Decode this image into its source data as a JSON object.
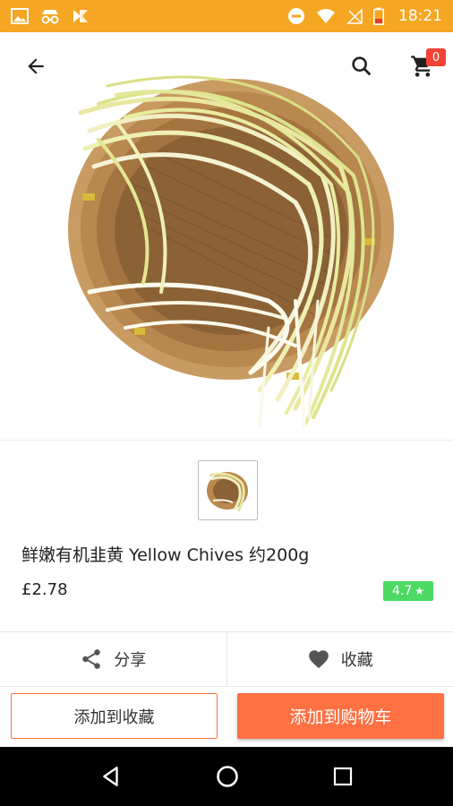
{
  "status_bar": {
    "time": "18:21",
    "icons_left": [
      "image-icon",
      "incognito-icon",
      "delivery-icon"
    ],
    "icons_right": [
      "do-not-disturb-icon",
      "wifi-icon",
      "no-signal-icon",
      "battery-icon"
    ]
  },
  "toolbar": {
    "cart_count": "0"
  },
  "product": {
    "title": "鲜嫩有机韭黄 Yellow Chives 约200g",
    "price": "£2.78",
    "rating": "4.7",
    "rating_star": "★"
  },
  "actions": {
    "share_label": "分享",
    "favorite_label": "收藏"
  },
  "bottom_buttons": {
    "add_to_favorites": "添加到收藏",
    "add_to_cart": "添加到购物车"
  },
  "colors": {
    "status_bar": "#f5a623",
    "accent": "#ff7043",
    "rating_bg": "#4cd964",
    "badge": "#f44336"
  }
}
